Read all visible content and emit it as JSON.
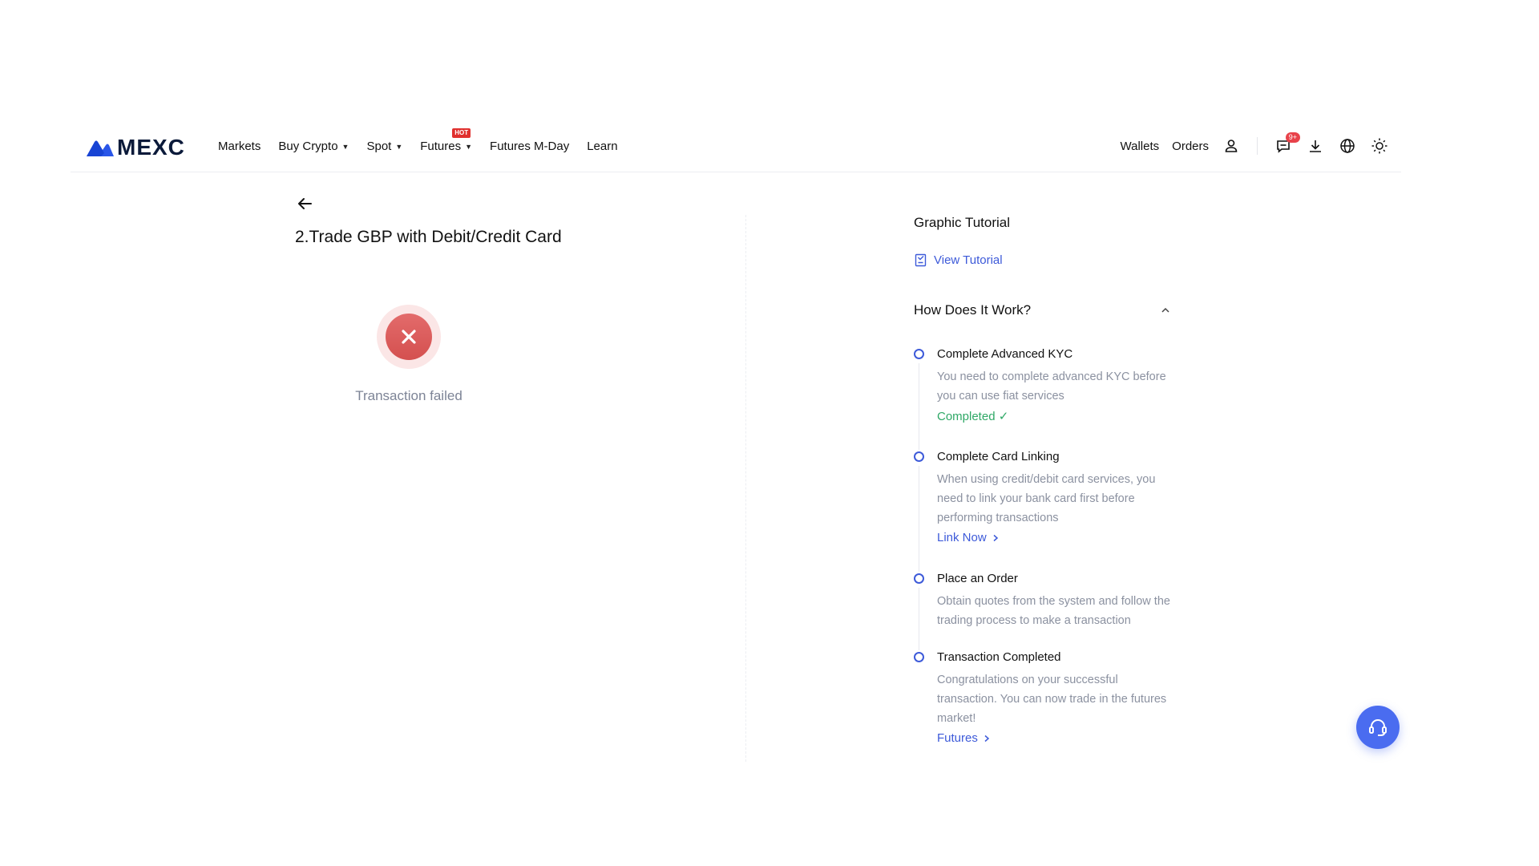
{
  "brand": {
    "name": "MEXC",
    "accent": "#3d5ad9",
    "logo_color": "#2a56e8"
  },
  "nav": {
    "items": [
      {
        "label": "Markets",
        "has_caret": false
      },
      {
        "label": "Buy Crypto",
        "has_caret": true
      },
      {
        "label": "Spot",
        "has_caret": true
      },
      {
        "label": "Futures",
        "has_caret": true,
        "badge": "HOT"
      },
      {
        "label": "Futures M-Day",
        "has_caret": false
      },
      {
        "label": "Learn",
        "has_caret": false
      }
    ],
    "right": {
      "wallets": "Wallets",
      "orders": "Orders",
      "notification_count": "9+",
      "icons": [
        "user-icon",
        "message-icon",
        "download-icon",
        "globe-icon",
        "sun-icon"
      ]
    }
  },
  "main": {
    "title": "2.Trade GBP with Debit/Credit Card",
    "status_text": "Transaction failed",
    "status_color": "#d4504f"
  },
  "sidebar": {
    "graphic_tutorial_title": "Graphic Tutorial",
    "view_tutorial_label": "View Tutorial",
    "how_title": "How Does It Work?",
    "steps": [
      {
        "title": "Complete Advanced KYC",
        "description": "You need to complete advanced KYC before you can use fiat services",
        "status": "Completed ✓"
      },
      {
        "title": "Complete Card Linking",
        "description": "When using credit/debit card services, you need to link your bank card first before performing transactions",
        "link": "Link Now"
      },
      {
        "title": "Place an Order",
        "description": "Obtain quotes from the system and follow the trading process to make a transaction"
      },
      {
        "title": "Transaction Completed",
        "description": "Congratulations on your successful transaction. You can now trade in the futures market!",
        "link": "Futures"
      }
    ]
  },
  "support": {
    "icon": "headset-icon"
  }
}
